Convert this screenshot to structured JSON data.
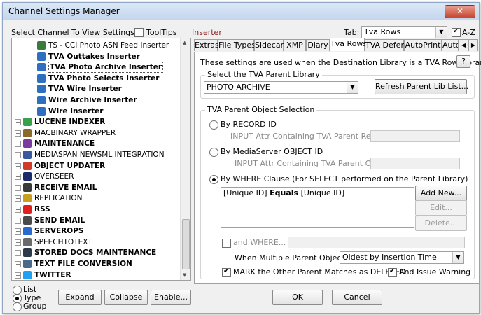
{
  "window": {
    "title": "Channel Settings Manager",
    "close_glyph": "✕"
  },
  "left": {
    "select_label": "Select Channel To View Settings:",
    "tooltips_label": "ToolTips",
    "tree": [
      {
        "label": "TS - CCI Photo ASN Feed Inserter",
        "bold": false,
        "indent": 2,
        "expand": false,
        "icon": "script-icon",
        "color": "#3a7a3a"
      },
      {
        "label": "TVA Outtakes Inserter",
        "bold": true,
        "indent": 2,
        "expand": false,
        "icon": "funnel-icon",
        "color": "#2e6fbf"
      },
      {
        "label": "TVA Photo Archive Inserter",
        "bold": true,
        "indent": 2,
        "expand": false,
        "icon": "funnel-icon",
        "color": "#2e6fbf",
        "selected": true
      },
      {
        "label": "TVA Photo Selects Inserter",
        "bold": true,
        "indent": 2,
        "expand": false,
        "icon": "funnel-icon",
        "color": "#2e6fbf"
      },
      {
        "label": "TVA Wire Inserter",
        "bold": true,
        "indent": 2,
        "expand": false,
        "icon": "funnel-icon",
        "color": "#2e6fbf"
      },
      {
        "label": "Wire Archive Inserter",
        "bold": true,
        "indent": 2,
        "expand": false,
        "icon": "funnel-icon",
        "color": "#2e6fbf"
      },
      {
        "label": "Wire Inserter",
        "bold": true,
        "indent": 2,
        "expand": false,
        "icon": "funnel-icon",
        "color": "#2e6fbf"
      },
      {
        "label": "LUCENE INDEXER",
        "bold": true,
        "indent": 0,
        "expand": true,
        "icon": "leaf-icon",
        "color": "#3aa04a"
      },
      {
        "label": "MACBINARY WRAPPER",
        "bold": false,
        "indent": 0,
        "expand": true,
        "icon": "package-icon",
        "color": "#8a6a2a"
      },
      {
        "label": "MAINTENANCE",
        "bold": true,
        "indent": 0,
        "expand": true,
        "icon": "gear-icon",
        "color": "#7a3aa0"
      },
      {
        "label": "MEDIASPAN NEWSML INTEGRATION",
        "bold": false,
        "indent": 0,
        "expand": true,
        "icon": "newsml-icon",
        "color": "#3a5aa0"
      },
      {
        "label": "OBJECT UPDATER",
        "bold": true,
        "indent": 0,
        "expand": true,
        "icon": "update-icon",
        "color": "#d03a2a"
      },
      {
        "label": "OVERSEER",
        "bold": false,
        "indent": 0,
        "expand": true,
        "icon": "info-icon",
        "color": "#1a2a6a"
      },
      {
        "label": "RECEIVE EMAIL",
        "bold": true,
        "indent": 0,
        "expand": true,
        "icon": "pen-icon",
        "color": "#3a3a3a"
      },
      {
        "label": "REPLICATION",
        "bold": false,
        "indent": 0,
        "expand": true,
        "icon": "replication-icon",
        "color": "#c8a020"
      },
      {
        "label": "RSS",
        "bold": true,
        "indent": 0,
        "expand": true,
        "icon": "rss-icon",
        "color": "#e02020"
      },
      {
        "label": "SEND EMAIL",
        "bold": true,
        "indent": 0,
        "expand": true,
        "icon": "mail-icon",
        "color": "#4a4a4a"
      },
      {
        "label": "SERVEROPS",
        "bold": true,
        "indent": 0,
        "expand": true,
        "icon": "server-icon",
        "color": "#2a6ad0"
      },
      {
        "label": "SPEECHTOTEXT",
        "bold": false,
        "indent": 0,
        "expand": true,
        "icon": "speech-icon",
        "color": "#6a6a6a"
      },
      {
        "label": "STORED DOCS MAINTENANCE",
        "bold": true,
        "indent": 0,
        "expand": true,
        "icon": "disk-icon",
        "color": "#2a3a4a"
      },
      {
        "label": "TEXT FILE CONVERSION",
        "bold": true,
        "indent": 0,
        "expand": true,
        "icon": "document-icon",
        "color": "#4a6a8a"
      },
      {
        "label": "TWITTER",
        "bold": true,
        "indent": 0,
        "expand": true,
        "icon": "twitter-icon",
        "color": "#1da1f2"
      }
    ],
    "view_modes": [
      {
        "label": "List",
        "selected": false
      },
      {
        "label": "Type",
        "selected": true
      },
      {
        "label": "Group",
        "selected": false
      }
    ],
    "expand_label": "Expand",
    "collapse_label": "Collapse",
    "enable_label": "Enable..."
  },
  "right": {
    "channel_name": "Inserter",
    "tab_label": "Tab:",
    "tab_value": "Tva Rows",
    "az_label": "A-Z",
    "tabs": [
      "Extras",
      "File Types",
      "Sidecar",
      "XMP",
      "Diary",
      "Tva Rows",
      "TVA Defer",
      "AutoPrint",
      "AutoFi"
    ],
    "active_tab": "Tva Rows",
    "info_text": "These settings are used when the Destination Library is a TVA Row Library.",
    "help_label": "?",
    "parent_lib_group": "Select the TVA Parent Library",
    "parent_lib_value": "PHOTO ARCHIVE",
    "refresh_label": "Refresh Parent Lib List...",
    "parent_obj_group": "TVA Parent Object Selection",
    "by_record_label": "By RECORD ID",
    "record_input_label": "INPUT Attr Containing TVA Parent Record ID:",
    "by_mediaserver_label": "By MediaServer OBJECT ID",
    "object_input_label": "INPUT Attr Containing TVA Parent Object ID:",
    "by_where_label": "By WHERE Clause  (For SELECT performed on the Parent Library)",
    "where_clause": {
      "left": "[Unique ID]",
      "op": "Equals",
      "right": "[Unique ID]"
    },
    "add_new_label": "Add New...",
    "edit_label": "Edit...",
    "delete_label": "Delete...",
    "and_where_label": "and WHERE...",
    "multiple_match_label": "When Multiple Parent Objects Match:",
    "multiple_match_value": "Oldest by Insertion Time",
    "mark_deleted_label": "MARK the Other Parent Matches as DELETED",
    "issue_warning_label": "And Issue Warning",
    "ok_label": "OK",
    "cancel_label": "Cancel",
    "accent_color": "#8b1a1a"
  }
}
